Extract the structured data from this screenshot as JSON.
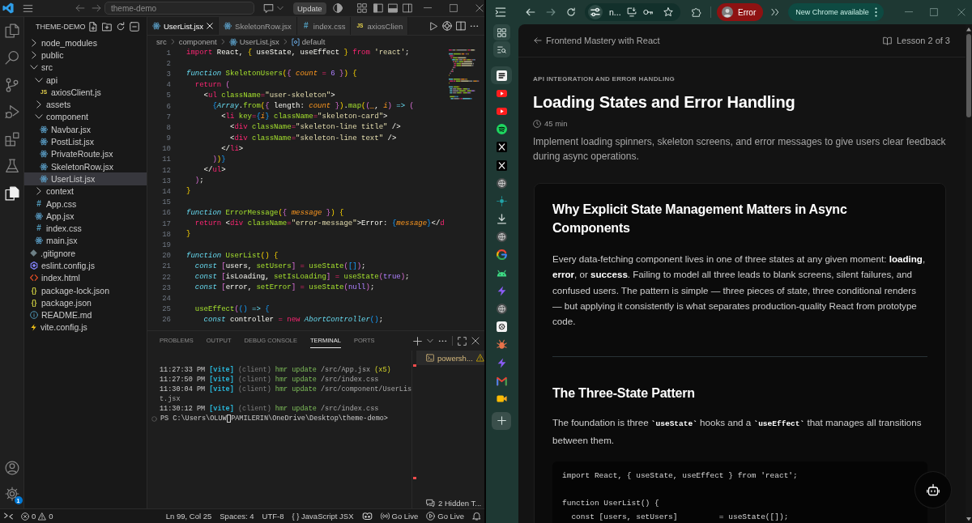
{
  "vscode": {
    "title_bar": {
      "command_center": "theme-demo",
      "update_button": "Update"
    },
    "activity_bar": {
      "items": [
        {
          "kind": "files",
          "selected": false
        },
        {
          "kind": "search",
          "selected": false
        },
        {
          "kind": "source_control",
          "selected": false
        },
        {
          "kind": "run_debug",
          "selected": false
        },
        {
          "kind": "extensions",
          "selected": false
        },
        {
          "kind": "testing",
          "selected": false
        },
        {
          "kind": "pages",
          "selected": true
        }
      ],
      "settings_badge": "1"
    },
    "explorer": {
      "title": "THEME-DEMO",
      "tree": [
        {
          "name": "node_modules",
          "kind": "folder",
          "expanded": false,
          "selected": false
        },
        {
          "name": "public",
          "kind": "folder",
          "expanded": false,
          "selected": false
        },
        {
          "name": "src",
          "kind": "folder",
          "expanded": true,
          "selected": false,
          "children": [
            {
              "name": "api",
              "kind": "folder",
              "expanded": true,
              "selected": false,
              "children": [
                {
                  "name": "axiosClient.js",
                  "kind": "js",
                  "icon_label": "JS",
                  "selected": false
                }
              ]
            },
            {
              "name": "assets",
              "kind": "folder",
              "expanded": false,
              "selected": false
            },
            {
              "name": "component",
              "kind": "folder",
              "expanded": true,
              "selected": false,
              "children": [
                {
                  "name": "Navbar.jsx",
                  "kind": "react",
                  "selected": false
                },
                {
                  "name": "PostList.jsx",
                  "kind": "react",
                  "selected": false
                },
                {
                  "name": "PrivateRoute.jsx",
                  "kind": "react",
                  "selected": false
                },
                {
                  "name": "SkeletonRow.jsx",
                  "kind": "react",
                  "selected": false
                },
                {
                  "name": "UserList.jsx",
                  "kind": "react",
                  "selected": true
                }
              ]
            },
            {
              "name": "context",
              "kind": "folder",
              "expanded": false,
              "selected": false
            },
            {
              "name": "App.css",
              "kind": "css",
              "icon_label": "#",
              "selected": false
            },
            {
              "name": "App.jsx",
              "kind": "react",
              "selected": false
            },
            {
              "name": "index.css",
              "kind": "css",
              "icon_label": "#",
              "selected": false
            },
            {
              "name": "main.jsx",
              "kind": "react",
              "selected": false
            }
          ]
        },
        {
          "name": ".gitignore",
          "kind": "gitignore",
          "selected": false
        },
        {
          "name": "eslint.config.js",
          "kind": "eslint",
          "selected": false
        },
        {
          "name": "index.html",
          "kind": "html",
          "selected": false
        },
        {
          "name": "package-lock.json",
          "kind": "json",
          "icon_label": "{}",
          "selected": false
        },
        {
          "name": "package.json",
          "kind": "json",
          "icon_label": "{}",
          "selected": false
        },
        {
          "name": "README.md",
          "kind": "info",
          "selected": false
        },
        {
          "name": "vite.config.js",
          "kind": "vite",
          "selected": false
        }
      ]
    },
    "editor": {
      "tabs": [
        {
          "label": "UserList.jsx",
          "kind": "react",
          "selected": true
        },
        {
          "label": "SkeletonRow.jsx",
          "kind": "react",
          "selected": false
        },
        {
          "label": "index.css",
          "kind": "css",
          "icon_label": "#",
          "selected": false
        },
        {
          "label": "axiosClien",
          "kind": "js",
          "icon_label": "JS",
          "selected": false
        }
      ],
      "breadcrumb": [
        {
          "label": "src",
          "kind": "folder"
        },
        {
          "label": "component",
          "kind": "folder"
        },
        {
          "label": "UserList.jsx",
          "kind": "react"
        },
        {
          "label": "default",
          "kind": "symbol"
        }
      ],
      "lines": [
        {
          "number": "1",
          "tokens": [
            {
              "kind": "keyword",
              "text": "import"
            },
            {
              "kind": "text",
              "text": " React, "
            },
            {
              "kind": "bracket1",
              "text": "{"
            },
            {
              "kind": "text",
              "text": " useState, useEffect "
            },
            {
              "kind": "bracket1",
              "text": "}"
            },
            {
              "kind": "keyword",
              "text": " from"
            },
            {
              "kind": "string",
              "text": " 'react'"
            },
            {
              "kind": "text",
              "text": ";"
            }
          ]
        },
        {
          "number": "2"
        },
        {
          "number": "3",
          "tokens": [
            {
              "kind": "storage",
              "text": "function"
            },
            {
              "kind": "name",
              "text": " SkeletonUsers"
            },
            {
              "kind": "bracket1",
              "text": "("
            },
            {
              "kind": "bracket2",
              "text": "{"
            },
            {
              "kind": "param",
              "text": " count"
            },
            {
              "kind": "op",
              "text": " ="
            },
            {
              "kind": "const",
              "text": " 6"
            },
            {
              "kind": "bracket2",
              "text": " }"
            },
            {
              "kind": "bracket1",
              "text": ")"
            },
            {
              "kind": "bracket1",
              "text": " {"
            }
          ]
        },
        {
          "number": "4",
          "tokens": [
            {
              "kind": "keyword",
              "text": "  return"
            },
            {
              "kind": "bracket2",
              "text": " ("
            }
          ]
        },
        {
          "number": "5",
          "tokens": [
            {
              "kind": "text",
              "text": "    <"
            },
            {
              "kind": "tag",
              "text": "ul"
            },
            {
              "kind": "attr",
              "text": " className"
            },
            {
              "kind": "op",
              "text": "="
            },
            {
              "kind": "string",
              "text": "\"user-skeleton\""
            },
            {
              "kind": "text",
              "text": ">"
            }
          ]
        },
        {
          "number": "6",
          "tokens": [
            {
              "kind": "bracket3",
              "text": "      {"
            },
            {
              "kind": "type",
              "text": "Array"
            },
            {
              "kind": "text",
              "text": "."
            },
            {
              "kind": "name",
              "text": "from"
            },
            {
              "kind": "bracket1",
              "text": "("
            },
            {
              "kind": "bracket2",
              "text": "{"
            },
            {
              "kind": "text",
              "text": " length: "
            },
            {
              "kind": "param",
              "text": "count"
            },
            {
              "kind": "bracket2",
              "text": " }"
            },
            {
              "kind": "bracket1",
              "text": ")"
            },
            {
              "kind": "text",
              "text": "."
            },
            {
              "kind": "name",
              "text": "map"
            },
            {
              "kind": "bracket1",
              "text": "("
            },
            {
              "kind": "bracket2",
              "text": "("
            },
            {
              "kind": "param",
              "text": "_"
            },
            {
              "kind": "text",
              "text": ", "
            },
            {
              "kind": "param",
              "text": "i"
            },
            {
              "kind": "bracket2",
              "text": ")"
            },
            {
              "kind": "storage",
              "text": " =>"
            },
            {
              "kind": "bracket2",
              "text": " ("
            }
          ]
        },
        {
          "number": "7",
          "tokens": [
            {
              "kind": "text",
              "text": "        <"
            },
            {
              "kind": "tag",
              "text": "li"
            },
            {
              "kind": "attr",
              "text": " key"
            },
            {
              "kind": "op",
              "text": "="
            },
            {
              "kind": "bracket3",
              "text": "{"
            },
            {
              "kind": "param",
              "text": "i"
            },
            {
              "kind": "bracket3",
              "text": "}"
            },
            {
              "kind": "attr",
              "text": " className"
            },
            {
              "kind": "op",
              "text": "="
            },
            {
              "kind": "string",
              "text": "\"skeleton-card\""
            },
            {
              "kind": "text",
              "text": ">"
            }
          ]
        },
        {
          "number": "8",
          "tokens": [
            {
              "kind": "text",
              "text": "          <"
            },
            {
              "kind": "tag",
              "text": "div"
            },
            {
              "kind": "attr",
              "text": " className"
            },
            {
              "kind": "op",
              "text": "="
            },
            {
              "kind": "string",
              "text": "\"skeleton-line title\""
            },
            {
              "kind": "text",
              "text": " />"
            }
          ]
        },
        {
          "number": "9",
          "tokens": [
            {
              "kind": "text",
              "text": "          <"
            },
            {
              "kind": "tag",
              "text": "div"
            },
            {
              "kind": "attr",
              "text": " className"
            },
            {
              "kind": "op",
              "text": "="
            },
            {
              "kind": "string",
              "text": "\"skeleton-line text\""
            },
            {
              "kind": "text",
              "text": " />"
            }
          ]
        },
        {
          "number": "10",
          "tokens": [
            {
              "kind": "text",
              "text": "        </"
            },
            {
              "kind": "tag",
              "text": "li"
            },
            {
              "kind": "text",
              "text": ">"
            }
          ]
        },
        {
          "number": "11",
          "tokens": [
            {
              "kind": "bracket2",
              "text": "      )"
            },
            {
              "kind": "bracket1",
              "text": ")"
            },
            {
              "kind": "bracket3",
              "text": "}"
            }
          ]
        },
        {
          "number": "12",
          "tokens": [
            {
              "kind": "text",
              "text": "    </"
            },
            {
              "kind": "tag",
              "text": "ul"
            },
            {
              "kind": "text",
              "text": ">"
            }
          ]
        },
        {
          "number": "13",
          "tokens": [
            {
              "kind": "bracket2",
              "text": "  )"
            },
            {
              "kind": "text",
              "text": ";"
            }
          ]
        },
        {
          "number": "14",
          "tokens": [
            {
              "kind": "bracket1",
              "text": "}"
            }
          ]
        },
        {
          "number": "15"
        },
        {
          "number": "16",
          "tokens": [
            {
              "kind": "storage",
              "text": "function"
            },
            {
              "kind": "name",
              "text": " ErrorMessage"
            },
            {
              "kind": "bracket1",
              "text": "("
            },
            {
              "kind": "bracket2",
              "text": "{"
            },
            {
              "kind": "param",
              "text": " message"
            },
            {
              "kind": "bracket2",
              "text": " }"
            },
            {
              "kind": "bracket1",
              "text": ")"
            },
            {
              "kind": "bracket1",
              "text": " {"
            }
          ]
        },
        {
          "number": "17",
          "tokens": [
            {
              "kind": "keyword",
              "text": "  return"
            },
            {
              "kind": "text",
              "text": " <"
            },
            {
              "kind": "tag",
              "text": "div"
            },
            {
              "kind": "attr",
              "text": " className"
            },
            {
              "kind": "op",
              "text": "="
            },
            {
              "kind": "string",
              "text": "\"error-message\""
            },
            {
              "kind": "text",
              "text": ">Error: "
            },
            {
              "kind": "bracket3",
              "text": "{"
            },
            {
              "kind": "param",
              "text": "message"
            },
            {
              "kind": "bracket3",
              "text": "}"
            },
            {
              "kind": "text",
              "text": "</"
            },
            {
              "kind": "tag",
              "text": "d"
            }
          ]
        },
        {
          "number": "18",
          "tokens": [
            {
              "kind": "bracket1",
              "text": "}"
            }
          ]
        },
        {
          "number": "19"
        },
        {
          "number": "20",
          "tokens": [
            {
              "kind": "storage",
              "text": "function"
            },
            {
              "kind": "name",
              "text": " UserList"
            },
            {
              "kind": "bracket1",
              "text": "()"
            },
            {
              "kind": "bracket1",
              "text": " {"
            }
          ]
        },
        {
          "number": "21",
          "tokens": [
            {
              "kind": "storage",
              "text": "  const"
            },
            {
              "kind": "bracket2",
              "text": " ["
            },
            {
              "kind": "text",
              "text": "users, "
            },
            {
              "kind": "name",
              "text": "setUsers"
            },
            {
              "kind": "bracket2",
              "text": "]"
            },
            {
              "kind": "op",
              "text": " ="
            },
            {
              "kind": "name",
              "text": " useState"
            },
            {
              "kind": "bracket2",
              "text": "("
            },
            {
              "kind": "bracket3",
              "text": "[]"
            },
            {
              "kind": "bracket2",
              "text": ")"
            },
            {
              "kind": "text",
              "text": ";"
            }
          ]
        },
        {
          "number": "22",
          "tokens": [
            {
              "kind": "storage",
              "text": "  const"
            },
            {
              "kind": "bracket2",
              "text": " ["
            },
            {
              "kind": "text",
              "text": "isLoading, "
            },
            {
              "kind": "name",
              "text": "setIsLoading"
            },
            {
              "kind": "bracket2",
              "text": "]"
            },
            {
              "kind": "op",
              "text": " ="
            },
            {
              "kind": "name",
              "text": " useState"
            },
            {
              "kind": "bracket2",
              "text": "("
            },
            {
              "kind": "const",
              "text": "true"
            },
            {
              "kind": "bracket2",
              "text": ")"
            },
            {
              "kind": "text",
              "text": ";"
            }
          ]
        },
        {
          "number": "23",
          "tokens": [
            {
              "kind": "storage",
              "text": "  const"
            },
            {
              "kind": "bracket2",
              "text": " ["
            },
            {
              "kind": "text",
              "text": "error, "
            },
            {
              "kind": "name",
              "text": "setError"
            },
            {
              "kind": "bracket2",
              "text": "]"
            },
            {
              "kind": "op",
              "text": " ="
            },
            {
              "kind": "name",
              "text": " useState"
            },
            {
              "kind": "bracket2",
              "text": "("
            },
            {
              "kind": "const",
              "text": "null"
            },
            {
              "kind": "bracket2",
              "text": ")"
            },
            {
              "kind": "text",
              "text": ";"
            }
          ]
        },
        {
          "number": "24"
        },
        {
          "number": "25",
          "tokens": [
            {
              "kind": "name",
              "text": "  useEffect"
            },
            {
              "kind": "bracket2",
              "text": "("
            },
            {
              "kind": "bracket3",
              "text": "()"
            },
            {
              "kind": "storage",
              "text": " =>"
            },
            {
              "kind": "bracket3",
              "text": " {"
            }
          ]
        },
        {
          "number": "26",
          "tokens": [
            {
              "kind": "storage",
              "text": "    const"
            },
            {
              "kind": "text",
              "text": " controller "
            },
            {
              "kind": "op",
              "text": "="
            },
            {
              "kind": "keyword",
              "text": " new"
            },
            {
              "kind": "type",
              "text": " AbortController"
            },
            {
              "kind": "bracket3",
              "text": "()"
            },
            {
              "kind": "text",
              "text": ";"
            }
          ]
        }
      ]
    },
    "panel": {
      "tabs": [
        {
          "label": "PROBLEMS",
          "selected": false
        },
        {
          "label": "OUTPUT",
          "selected": false
        },
        {
          "label": "DEBUG CONSOLE",
          "selected": false
        },
        {
          "label": "TERMINAL",
          "selected": true
        },
        {
          "label": "PORTS",
          "selected": false
        }
      ],
      "terminal_lines": [
        {
          "tokens": [
            {
              "kind": "time",
              "text": "11:27:33 PM "
            },
            {
              "kind": "label",
              "text": "[vite]"
            },
            {
              "kind": "dim",
              "text": " (client) "
            },
            {
              "kind": "action",
              "text": "hmr update "
            },
            {
              "kind": "path",
              "text": "/src/App.jsx "
            },
            {
              "kind": "count",
              "text": "(x5)"
            }
          ]
        },
        {
          "tokens": [
            {
              "kind": "time",
              "text": "11:27:50 PM "
            },
            {
              "kind": "label",
              "text": "[vite]"
            },
            {
              "kind": "dim",
              "text": " (client) "
            },
            {
              "kind": "action",
              "text": "hmr update "
            },
            {
              "kind": "path",
              "text": "/src/index.css"
            }
          ]
        },
        {
          "tokens": [
            {
              "kind": "time",
              "text": "11:30:04 PM "
            },
            {
              "kind": "label",
              "text": "[vite]"
            },
            {
              "kind": "dim",
              "text": " (client) "
            },
            {
              "kind": "action",
              "text": "hmr update "
            },
            {
              "kind": "path",
              "text": "/src/component/UserLis"
            }
          ]
        },
        {
          "tokens": [
            {
              "kind": "path",
              "text": "t.jsx"
            }
          ]
        },
        {
          "tokens": [
            {
              "kind": "time",
              "text": "11:30:12 PM "
            },
            {
              "kind": "label",
              "text": "[vite]"
            },
            {
              "kind": "dim",
              "text": " (client) "
            },
            {
              "kind": "action",
              "text": "hmr update "
            },
            {
              "kind": "path",
              "text": "/src/index.css"
            }
          ]
        }
      ],
      "prompt": {
        "before_cursor": "PS C:\\Users\\OLUW",
        "after_cursor": "PAMILERIN\\OneDrive\\Desktop\\theme-demo>"
      },
      "terminals": [
        {
          "label": "powersh...",
          "warning": true
        }
      ],
      "hidden_terminals": "2 Hidden T..."
    },
    "status_bar": {
      "errors": "0",
      "warnings": "0",
      "items": [
        "Ln 99, Col 25",
        "Spaces: 4",
        "UTF-8",
        "{ } JavaScript JSX"
      ],
      "live": [
        {
          "label": "Go Live",
          "kind": "broadcast"
        },
        {
          "label": "Go Live",
          "kind": "play"
        }
      ]
    }
  },
  "chrome": {
    "toolbar": {
      "address": "n...",
      "profile": "Error",
      "update_pill": "New Chrome available"
    },
    "vertical_tabs": [
      {
        "kind": "notebook",
        "selected": true
      },
      {
        "kind": "play",
        "selected": false
      },
      {
        "kind": "play",
        "selected": false
      },
      {
        "kind": "waves",
        "selected": false
      },
      {
        "kind": "cross",
        "selected": false
      },
      {
        "kind": "cross",
        "selected": false
      },
      {
        "kind": "globe",
        "selected": false
      },
      {
        "kind": "dot",
        "selected": false
      },
      {
        "kind": "download",
        "selected": false
      },
      {
        "kind": "globe",
        "selected": false
      },
      {
        "kind": "ring",
        "selected": false
      },
      {
        "kind": "robot",
        "selected": false
      },
      {
        "kind": "bolt",
        "selected": false
      },
      {
        "kind": "globe",
        "selected": false
      },
      {
        "kind": "knot",
        "selected": false
      },
      {
        "kind": "bug",
        "selected": false
      },
      {
        "kind": "bolt",
        "selected": false
      },
      {
        "kind": "mail",
        "selected": false
      },
      {
        "kind": "camera",
        "selected": false
      }
    ],
    "page": {
      "back_link": "Frontend Mastery with React",
      "lesson_number": "Lesson 2 of 3",
      "category": "API INTEGRATION AND ERROR HANDLING",
      "title": "Loading States and Error Handling",
      "duration": "45 min",
      "summary": "Implement loading spinners, skeleton screens, and error messages to give users clear feedback during async operations.",
      "sections": [
        {
          "heading": "Why Explicit State Management Matters in Async Components",
          "paragraph": [
            {
              "kind": "text",
              "text": "Every data-fetching component lives in one of three states at any given moment: **loading**, **error**, or **success**. Failing to model all three leads to blank screens, silent failures, and confused users. The pattern is simple — three pieces of state, three conditional renders — but applying it consistently is what separates production-quality React from prototype code."
            }
          ]
        },
        {
          "heading": "The Three-State Pattern",
          "paragraph": [
            {
              "kind": "text",
              "text": "The foundation is three "
            },
            {
              "kind": "code",
              "text": "`useState`"
            },
            {
              "kind": "text",
              "text": " hooks and a "
            },
            {
              "kind": "code",
              "text": "`useEffect`"
            },
            {
              "kind": "text",
              "text": " that manages all transitions between them."
            }
          ],
          "code": [
            {
              "lines": [
                "import React, { useState, useEffect } from 'react';"
              ]
            },
            {
              "lines": [
                "function UserList() {",
                "  const [users, setUsers]         = useState([]);"
              ]
            }
          ]
        }
      ]
    }
  }
}
